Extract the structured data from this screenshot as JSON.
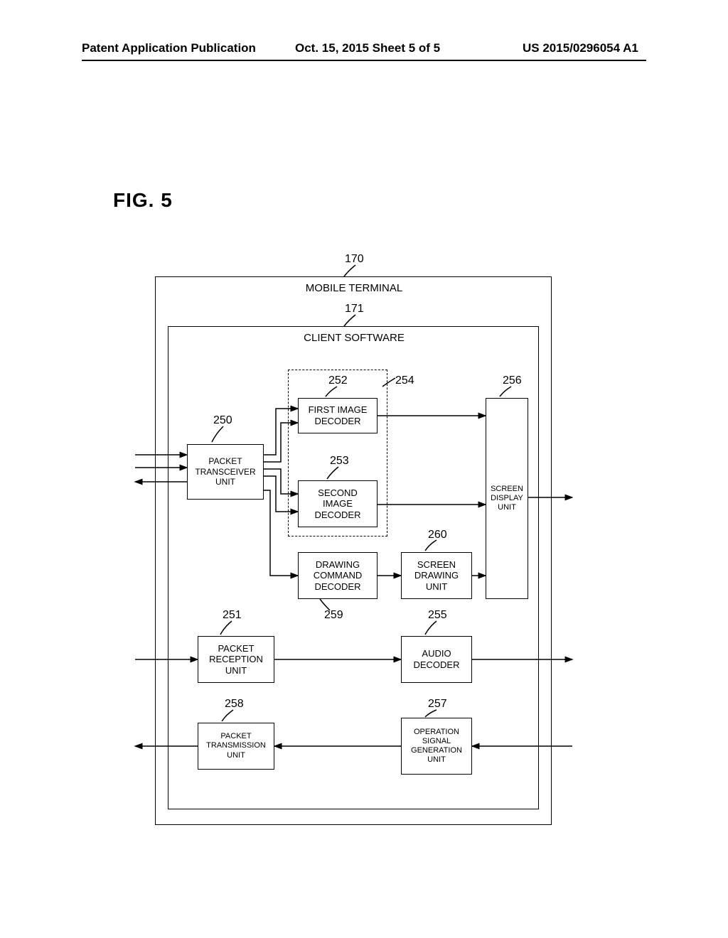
{
  "header": {
    "left": "Patent Application Publication",
    "center": "Oct. 15, 2015  Sheet 5 of 5",
    "right": "US 2015/0296054 A1"
  },
  "figure_label": "FIG. 5",
  "refs": {
    "r170": "170",
    "r171": "171",
    "r250": "250",
    "r251": "251",
    "r252": "252",
    "r253": "253",
    "r254": "254",
    "r255": "255",
    "r256": "256",
    "r257": "257",
    "r258": "258",
    "r259": "259",
    "r260": "260"
  },
  "titles": {
    "mobile_terminal": "MOBILE TERMINAL",
    "client_software": "CLIENT SOFTWARE"
  },
  "blocks": {
    "packet_transceiver": "PACKET\nTRANSCEIVER\nUNIT",
    "first_image_decoder": "FIRST IMAGE\nDECODER",
    "second_image_decoder": "SECOND\nIMAGE\nDECODER",
    "drawing_command_decoder": "DRAWING\nCOMMAND\nDECODER",
    "screen_drawing": "SCREEN\nDRAWING\nUNIT",
    "screen_display": "SCREEN\nDISPLAY\nUNIT",
    "packet_reception": "PACKET\nRECEPTION\nUNIT",
    "audio_decoder": "AUDIO\nDECODER",
    "packet_transmission": "PACKET\nTRANSMISSION\nUNIT",
    "operation_signal": "OPERATION\nSIGNAL\nGENERATION\nUNIT"
  }
}
